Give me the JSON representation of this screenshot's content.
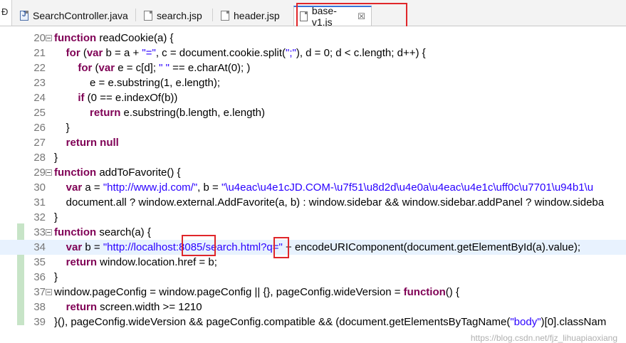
{
  "tabs": [
    {
      "label": "SearchController.java",
      "icon": "java-file-icon",
      "active": false
    },
    {
      "label": "search.jsp",
      "icon": "jsp-file-icon",
      "active": false
    },
    {
      "label": "header.jsp",
      "icon": "jsp-file-icon",
      "active": false
    },
    {
      "label": "base-v1.js",
      "icon": "js-file-icon",
      "active": true,
      "close": "☒"
    }
  ],
  "left_stub_glyph": "Đ",
  "colors": {
    "keyword": "#7f0055",
    "string": "#2a00ff",
    "annotation_box": "#e0262a",
    "current_line": "#e8f2fe",
    "change_bar": "#c7e4c7"
  },
  "lines": [
    {
      "n": "20",
      "fold": true,
      "segments": [
        {
          "t": "kw",
          "v": "function"
        },
        {
          "t": "",
          "v": " readCookie(a) {"
        }
      ]
    },
    {
      "n": "21",
      "segments": [
        {
          "t": "",
          "v": "    "
        },
        {
          "t": "kw",
          "v": "for"
        },
        {
          "t": "",
          "v": " ("
        },
        {
          "t": "kw",
          "v": "var"
        },
        {
          "t": "",
          "v": " b = a + "
        },
        {
          "t": "str",
          "v": "\"=\""
        },
        {
          "t": "",
          "v": ", c = document.cookie.split("
        },
        {
          "t": "str",
          "v": "\";\""
        },
        {
          "t": "",
          "v": "), d = 0; d < c.length; d++) {"
        }
      ]
    },
    {
      "n": "22",
      "segments": [
        {
          "t": "",
          "v": "        "
        },
        {
          "t": "kw",
          "v": "for"
        },
        {
          "t": "",
          "v": " ("
        },
        {
          "t": "kw",
          "v": "var"
        },
        {
          "t": "",
          "v": " e = c[d]; "
        },
        {
          "t": "str",
          "v": "\" \""
        },
        {
          "t": "",
          "v": " == e.charAt(0); )"
        }
      ]
    },
    {
      "n": "23",
      "segments": [
        {
          "t": "",
          "v": "            e = e.substring(1, e.length);"
        }
      ]
    },
    {
      "n": "24",
      "segments": [
        {
          "t": "",
          "v": "        "
        },
        {
          "t": "kw",
          "v": "if"
        },
        {
          "t": "",
          "v": " (0 == e.indexOf(b))"
        }
      ]
    },
    {
      "n": "25",
      "segments": [
        {
          "t": "",
          "v": "            "
        },
        {
          "t": "kw",
          "v": "return"
        },
        {
          "t": "",
          "v": " e.substring(b.length, e.length)"
        }
      ]
    },
    {
      "n": "26",
      "segments": [
        {
          "t": "",
          "v": "    }"
        }
      ]
    },
    {
      "n": "27",
      "segments": [
        {
          "t": "",
          "v": "    "
        },
        {
          "t": "kw",
          "v": "return null"
        }
      ]
    },
    {
      "n": "28",
      "segments": [
        {
          "t": "",
          "v": "}"
        }
      ]
    },
    {
      "n": "29",
      "fold": true,
      "segments": [
        {
          "t": "kw",
          "v": "function"
        },
        {
          "t": "",
          "v": " addToFavorite() {"
        }
      ]
    },
    {
      "n": "30",
      "segments": [
        {
          "t": "",
          "v": "    "
        },
        {
          "t": "kw",
          "v": "var"
        },
        {
          "t": "",
          "v": " a = "
        },
        {
          "t": "str",
          "v": "\"http://www.jd.com/\""
        },
        {
          "t": "",
          "v": ", b = "
        },
        {
          "t": "str",
          "v": "\"\\u4eac\\u4e1cJD.COM-\\u7f51\\u8d2d\\u4e0a\\u4eac\\u4e1c\\uff0c\\u7701\\u94b1\\u"
        }
      ]
    },
    {
      "n": "31",
      "segments": [
        {
          "t": "",
          "v": "    document.all ? window.external.AddFavorite(a, b) : window.sidebar && window.sidebar.addPanel ? window.sideba"
        }
      ]
    },
    {
      "n": "32",
      "segments": [
        {
          "t": "",
          "v": "}"
        }
      ]
    },
    {
      "n": "33",
      "fold": true,
      "segments": [
        {
          "t": "kw",
          "v": "function"
        },
        {
          "t": "",
          "v": " search(a) {"
        }
      ]
    },
    {
      "n": "34",
      "current": true,
      "segments": [
        {
          "t": "",
          "v": "    "
        },
        {
          "t": "kw",
          "v": "var"
        },
        {
          "t": "",
          "v": " b = "
        },
        {
          "t": "str",
          "v": "\"http://localhost:8085/search.html?q=\""
        },
        {
          "t": "",
          "v": " + encodeURIComponent(document.getElementById(a).value);"
        }
      ]
    },
    {
      "n": "35",
      "segments": [
        {
          "t": "",
          "v": "    "
        },
        {
          "t": "kw",
          "v": "return"
        },
        {
          "t": "",
          "v": " window.location.href = b;"
        }
      ]
    },
    {
      "n": "36",
      "segments": [
        {
          "t": "",
          "v": "}"
        }
      ]
    },
    {
      "n": "37",
      "fold": true,
      "segments": [
        {
          "t": "",
          "v": "window.pageConfig = window.pageConfig || {}, pageConfig.wideVersion = "
        },
        {
          "t": "kw",
          "v": "function"
        },
        {
          "t": "",
          "v": "() {"
        }
      ]
    },
    {
      "n": "38",
      "segments": [
        {
          "t": "",
          "v": "    "
        },
        {
          "t": "kw",
          "v": "return"
        },
        {
          "t": "",
          "v": " screen.width >= 1210"
        }
      ]
    },
    {
      "n": "39",
      "segments": [
        {
          "t": "",
          "v": "}(), pageConfig.wideVersion && pageConfig.compatible && (document.getElementsByTagName("
        },
        {
          "t": "str",
          "v": "\"body\""
        },
        {
          "t": "",
          "v": ")[0].classNam"
        }
      ]
    }
  ],
  "watermark": "https://blog.csdn.net/fjz_lihuapiaoxiang"
}
